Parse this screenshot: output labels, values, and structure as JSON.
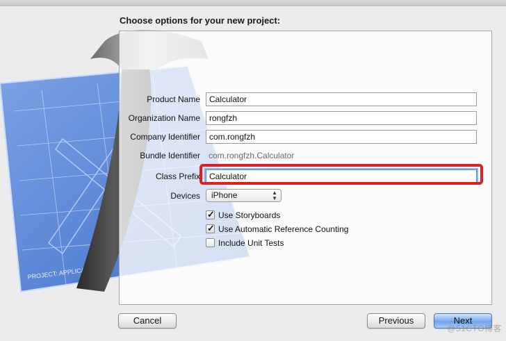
{
  "heading": "Choose options for your new project:",
  "fields": {
    "product_name": {
      "label": "Product Name",
      "value": "Calculator"
    },
    "organization_name": {
      "label": "Organization Name",
      "value": "rongfzh"
    },
    "company_identifier": {
      "label": "Company Identifier",
      "value": "com.rongfzh"
    },
    "bundle_identifier": {
      "label": "Bundle Identifier",
      "value": "com.rongfzh.Calculator"
    },
    "class_prefix": {
      "label": "Class Prefix",
      "value": "Calculator"
    },
    "devices": {
      "label": "Devices",
      "value": "iPhone"
    }
  },
  "options": [
    {
      "label": "Use Storyboards",
      "checked": true
    },
    {
      "label": "Use Automatic Reference Counting",
      "checked": true
    },
    {
      "label": "Include Unit Tests",
      "checked": false
    }
  ],
  "buttons": {
    "cancel": "Cancel",
    "previous": "Previous",
    "next": "Next"
  },
  "watermark": "@51CTO博客",
  "colors": {
    "highlight": "#e02020",
    "focus_ring": "#8ab3ee",
    "default_button": "#6a9ee9"
  }
}
